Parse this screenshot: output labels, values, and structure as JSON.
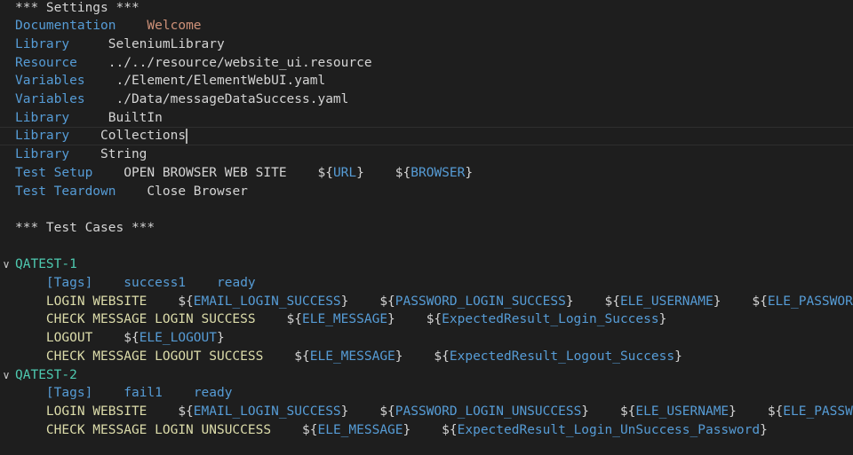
{
  "colors": {
    "background": "#1e1e1e",
    "default": "#d4d4d4",
    "keyword": "#569cd6",
    "string": "#ce9178",
    "testcase": "#4ec9b0",
    "keyword_call": "#dcdcaa",
    "variable": "#569cd6"
  },
  "icons": {
    "fold": "chevron-down-icon"
  },
  "lines": [
    {
      "tokens": [
        {
          "t": "*** Settings ***",
          "c": "w"
        }
      ]
    },
    {
      "tokens": [
        {
          "t": "Documentation",
          "c": "k"
        },
        {
          "t": "    ",
          "c": "w"
        },
        {
          "t": "Welcome",
          "c": "s"
        }
      ]
    },
    {
      "tokens": [
        {
          "t": "Library",
          "c": "k"
        },
        {
          "t": "     SeleniumLibrary",
          "c": "w"
        }
      ]
    },
    {
      "tokens": [
        {
          "t": "Resource",
          "c": "k"
        },
        {
          "t": "    ../../resource/website_ui.resource",
          "c": "w"
        }
      ]
    },
    {
      "tokens": [
        {
          "t": "Variables",
          "c": "k"
        },
        {
          "t": "    ./Element/ElementWebUI.yaml",
          "c": "w"
        }
      ]
    },
    {
      "tokens": [
        {
          "t": "Variables",
          "c": "k"
        },
        {
          "t": "    ./Data/messageDataSuccess.yaml",
          "c": "w"
        }
      ]
    },
    {
      "tokens": [
        {
          "t": "Library",
          "c": "k"
        },
        {
          "t": "     BuiltIn",
          "c": "w"
        }
      ]
    },
    {
      "active": true,
      "cursor": true,
      "tokens": [
        {
          "t": "Library",
          "c": "k"
        },
        {
          "t": "    Collections",
          "c": "w"
        }
      ]
    },
    {
      "tokens": [
        {
          "t": "Library",
          "c": "k"
        },
        {
          "t": "    String",
          "c": "w"
        }
      ]
    },
    {
      "tokens": [
        {
          "t": "Test Setup",
          "c": "k"
        },
        {
          "t": "    OPEN BROWSER WEB SITE    ${",
          "c": "w"
        },
        {
          "t": "URL",
          "c": "v"
        },
        {
          "t": "}    ${",
          "c": "w"
        },
        {
          "t": "BROWSER",
          "c": "v"
        },
        {
          "t": "}",
          "c": "w"
        }
      ]
    },
    {
      "tokens": [
        {
          "t": "Test Teardown",
          "c": "k"
        },
        {
          "t": "    Close Browser",
          "c": "w"
        }
      ]
    },
    {
      "tokens": []
    },
    {
      "tokens": [
        {
          "t": "*** Test Cases ***",
          "c": "w"
        }
      ]
    },
    {
      "tokens": []
    },
    {
      "fold": true,
      "tokens": [
        {
          "t": "QATEST-1",
          "c": "t"
        }
      ]
    },
    {
      "tokens": [
        {
          "t": "    ",
          "c": "w"
        },
        {
          "t": "[Tags]",
          "c": "k"
        },
        {
          "t": "    ",
          "c": "w"
        },
        {
          "t": "success1",
          "c": "k"
        },
        {
          "t": "    ",
          "c": "w"
        },
        {
          "t": "ready",
          "c": "k"
        }
      ]
    },
    {
      "tokens": [
        {
          "t": "    LOGIN WEBSITE",
          "c": "y"
        },
        {
          "t": "    ${",
          "c": "w"
        },
        {
          "t": "EMAIL_LOGIN_SUCCESS",
          "c": "v"
        },
        {
          "t": "}    ${",
          "c": "w"
        },
        {
          "t": "PASSWORD_LOGIN_SUCCESS",
          "c": "v"
        },
        {
          "t": "}    ${",
          "c": "w"
        },
        {
          "t": "ELE_USERNAME",
          "c": "v"
        },
        {
          "t": "}    ${",
          "c": "w"
        },
        {
          "t": "ELE_PASSWORD",
          "c": "v"
        },
        {
          "t": "}",
          "c": "w"
        }
      ]
    },
    {
      "tokens": [
        {
          "t": "    CHECK MESSAGE LOGIN SUCCESS",
          "c": "y"
        },
        {
          "t": "    ${",
          "c": "w"
        },
        {
          "t": "ELE_MESSAGE",
          "c": "v"
        },
        {
          "t": "}    ${",
          "c": "w"
        },
        {
          "t": "ExpectedResult_Login_Success",
          "c": "v"
        },
        {
          "t": "}",
          "c": "w"
        }
      ]
    },
    {
      "tokens": [
        {
          "t": "    LOGOUT",
          "c": "y"
        },
        {
          "t": "    ${",
          "c": "w"
        },
        {
          "t": "ELE_LOGOUT",
          "c": "v"
        },
        {
          "t": "}",
          "c": "w"
        }
      ]
    },
    {
      "tokens": [
        {
          "t": "    CHECK MESSAGE LOGOUT SUCCESS",
          "c": "y"
        },
        {
          "t": "    ${",
          "c": "w"
        },
        {
          "t": "ELE_MESSAGE",
          "c": "v"
        },
        {
          "t": "}    ${",
          "c": "w"
        },
        {
          "t": "ExpectedResult_Logout_Success",
          "c": "v"
        },
        {
          "t": "}",
          "c": "w"
        }
      ]
    },
    {
      "fold": true,
      "tokens": [
        {
          "t": "QATEST-2",
          "c": "t"
        }
      ]
    },
    {
      "tokens": [
        {
          "t": "    ",
          "c": "w"
        },
        {
          "t": "[Tags]",
          "c": "k"
        },
        {
          "t": "    ",
          "c": "w"
        },
        {
          "t": "fail1",
          "c": "k"
        },
        {
          "t": "    ",
          "c": "w"
        },
        {
          "t": "ready",
          "c": "k"
        }
      ]
    },
    {
      "tokens": [
        {
          "t": "    LOGIN WEBSITE",
          "c": "y"
        },
        {
          "t": "    ${",
          "c": "w"
        },
        {
          "t": "EMAIL_LOGIN_SUCCESS",
          "c": "v"
        },
        {
          "t": "}    ${",
          "c": "w"
        },
        {
          "t": "PASSWORD_LOGIN_UNSUCCESS",
          "c": "v"
        },
        {
          "t": "}    ${",
          "c": "w"
        },
        {
          "t": "ELE_USERNAME",
          "c": "v"
        },
        {
          "t": "}    ${",
          "c": "w"
        },
        {
          "t": "ELE_PASSWORD",
          "c": "v"
        },
        {
          "t": "}",
          "c": "w"
        }
      ]
    },
    {
      "tokens": [
        {
          "t": "    CHECK MESSAGE LOGIN UNSUCCESS",
          "c": "y"
        },
        {
          "t": "    ${",
          "c": "w"
        },
        {
          "t": "ELE_MESSAGE",
          "c": "v"
        },
        {
          "t": "}    ${",
          "c": "w"
        },
        {
          "t": "ExpectedResult_Login_UnSuccess_Password",
          "c": "v"
        },
        {
          "t": "}",
          "c": "w"
        }
      ]
    }
  ]
}
